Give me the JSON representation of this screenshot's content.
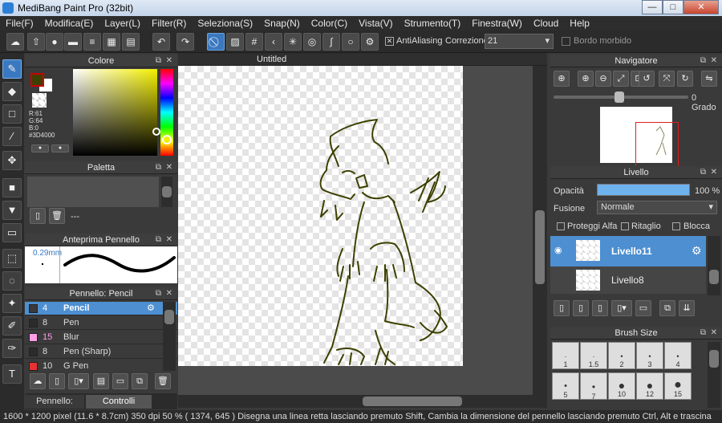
{
  "window": {
    "title": "MediBang Paint Pro (32bit)",
    "min": "—",
    "max": "□",
    "close": "✕"
  },
  "menu": [
    "File(F)",
    "Modifica(E)",
    "Layer(L)",
    "Filter(R)",
    "Seleziona(S)",
    "Snap(N)",
    "Color(C)",
    "Vista(V)",
    "Strumento(T)",
    "Finestra(W)",
    "Cloud",
    "Help"
  ],
  "toolbar": {
    "antialias_label": "AntiAliasing",
    "correction_label": "Correzione",
    "correction_value": "21",
    "soft_edge_label": "Bordo morbido"
  },
  "color_panel": {
    "title": "Colore",
    "r": "R:61",
    "g": "G:64",
    "b": "B:0",
    "hex": "#3D4000",
    "fg": "#3d4000"
  },
  "palette_panel": {
    "title": "Paletta",
    "empty": "---"
  },
  "brush_preview": {
    "title": "Anteprima Pennello",
    "size": "0.29mm"
  },
  "brush_panel": {
    "title": "Pennello: Pencil",
    "items": [
      {
        "size": "4",
        "name": "Pencil",
        "color": "#3a3a3a",
        "selected": true
      },
      {
        "size": "8",
        "name": "Pen",
        "color": "#2b2b2b"
      },
      {
        "size": "15",
        "name": "Blur",
        "color": "#ff9ee8"
      },
      {
        "size": "8",
        "name": "Pen (Sharp)",
        "color": "#2b2b2b"
      },
      {
        "size": "10",
        "name": "G Pen",
        "color": "#e83232"
      }
    ]
  },
  "bottom_tabs": [
    "Pennello: Pencil",
    "Controlli Pennello"
  ],
  "canvas": {
    "tab": "Untitled"
  },
  "navigator": {
    "title": "Navigatore",
    "angle": "0 Grado"
  },
  "layer_panel": {
    "title": "Livello",
    "opacity_label": "Opacità",
    "opacity_value": "100 %",
    "opacity": 1.0,
    "blend_label": "Fusione",
    "blend_value": "Normale",
    "protect_alpha": "Proteggi Alfa",
    "clipping": "Ritaglio",
    "lock": "Blocca",
    "layers": [
      {
        "name": "Livello11",
        "selected": true
      },
      {
        "name": "Livello8",
        "selected": false
      }
    ]
  },
  "brush_size": {
    "title": "Brush Size",
    "sizes": [
      "1",
      "1.5",
      "2",
      "3",
      "4",
      "5",
      "7",
      "10",
      "12",
      "15"
    ]
  },
  "status": {
    "text": "1600 * 1200 pixel   (11.6 * 8.7cm)   350 dpi   50 %   ( 1374, 645 )   Disegna una linea retta lasciando premuto Shift, Cambia la dimensione del pennello lasciando premuto Ctrl, Alt e trascina"
  }
}
